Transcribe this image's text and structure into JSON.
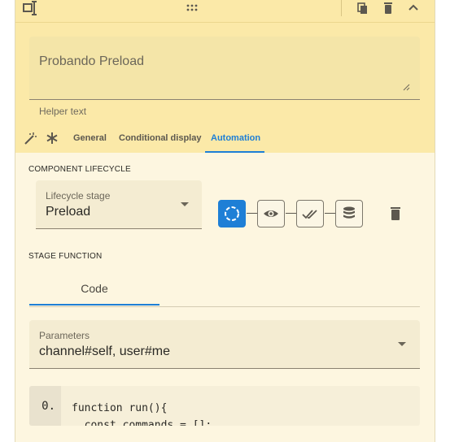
{
  "field": {
    "value": "Probando Preload",
    "helper_text": "Helper text"
  },
  "tabs": [
    {
      "label": "General"
    },
    {
      "label": "Conditional display"
    },
    {
      "label": "Automation"
    }
  ],
  "lifecycle": {
    "section_title": "COMPONENT LIFECYCLE",
    "stage_label": "Lifecycle stage",
    "stage_value": "Preload",
    "stages": [
      "loading-icon",
      "eye-icon",
      "double-check-icon",
      "database-icon"
    ]
  },
  "stage_function": {
    "section_title": "STAGE FUNCTION",
    "code_tab": "Code",
    "parameters_label": "Parameters",
    "parameters_value": "channel#self, user#me",
    "gutter": "0.",
    "code_lines": [
      "function run(){",
      "  const commands = [];"
    ]
  },
  "colors": {
    "accent": "#1e7fd6",
    "header_bg": "#fbe9a8",
    "panel_bg": "#fdf6e0"
  }
}
